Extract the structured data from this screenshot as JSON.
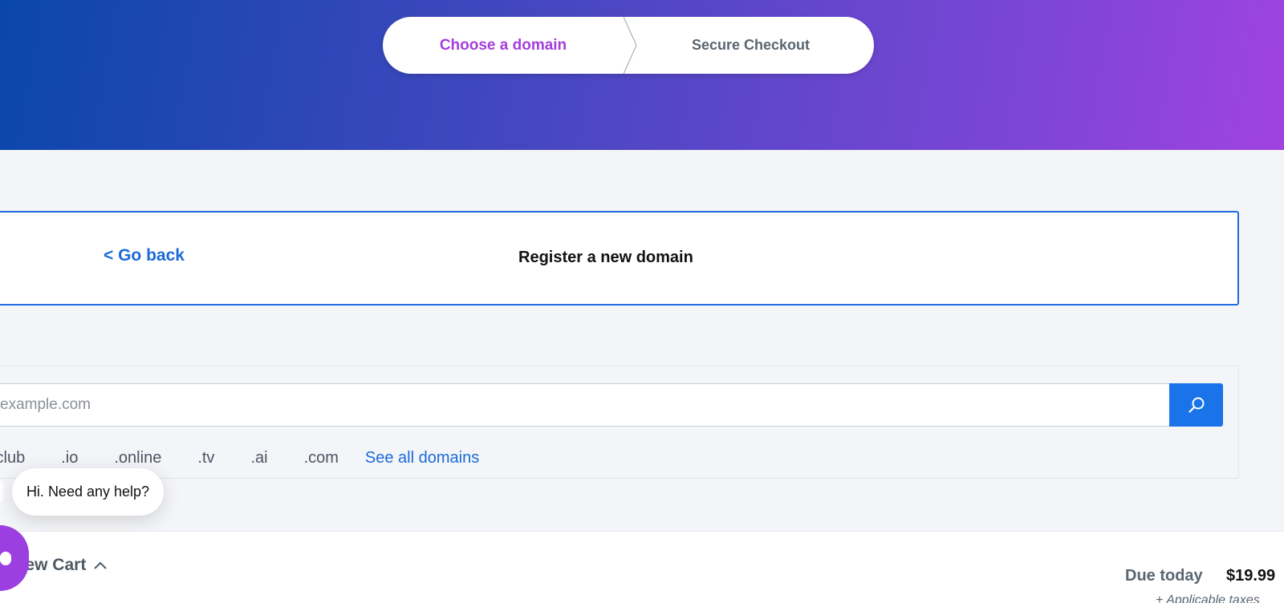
{
  "header": {
    "steps": [
      {
        "label": "Choose a domain",
        "color": "#a43fdc",
        "active": true
      },
      {
        "label": "Secure Checkout",
        "active": false
      }
    ]
  },
  "register": {
    "back_label": "< Go back",
    "title": "Register a new domain"
  },
  "search": {
    "placeholder": "example.com",
    "button_icon": "search-icon",
    "tlds": [
      ".club",
      ".io",
      ".online",
      ".tv",
      ".ai",
      ".com"
    ],
    "see_all_label": "See all domains"
  },
  "help": {
    "bubble_text": "Hi. Need any help?"
  },
  "cart": {
    "view_cart_label": "View Cart",
    "due_label": "Due today",
    "due_amount": "$19.99",
    "taxes_note": "+ Applicable taxes"
  },
  "colors": {
    "accent_blue": "#1a73e8",
    "accent_purple": "#9b3fe0",
    "link_blue": "#1a6ad8"
  }
}
